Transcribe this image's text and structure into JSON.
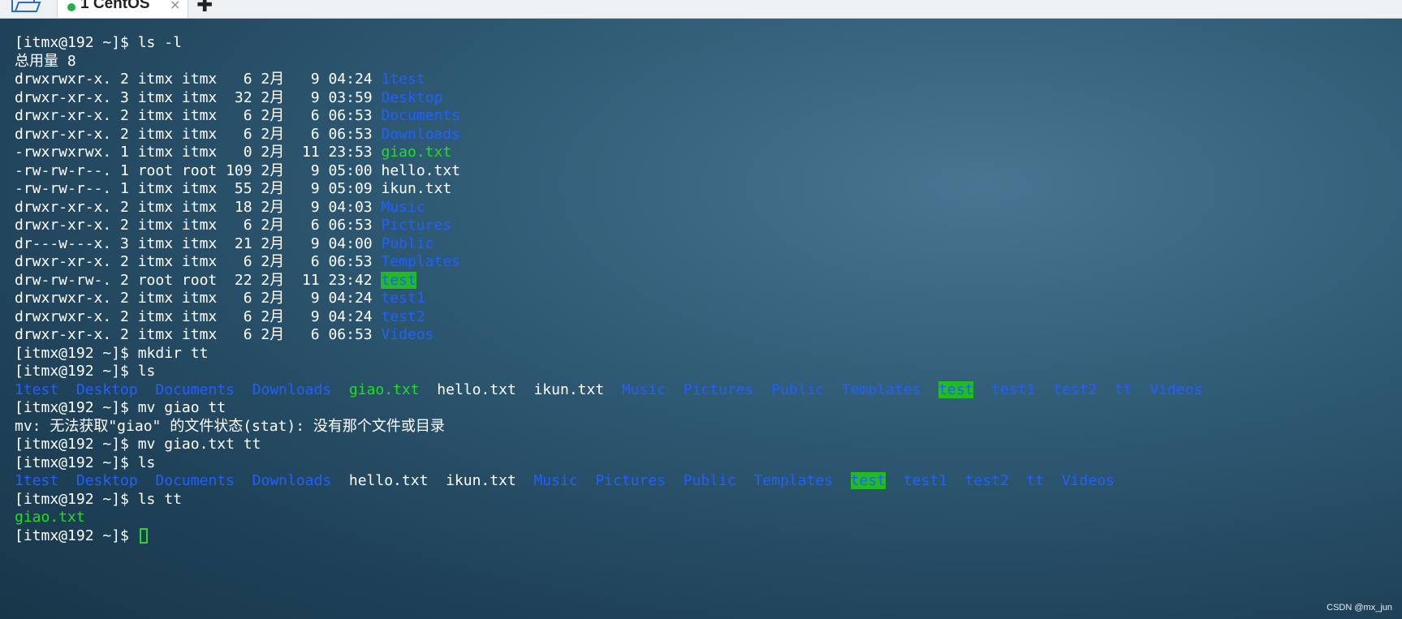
{
  "tabbar": {
    "tab_label": "1 CentOS",
    "tab_close": "×",
    "new_tab": "✚"
  },
  "terminal": {
    "lines": [
      [
        {
          "text": "[itmx@192 ~]$ ls -l",
          "style": "plain"
        }
      ],
      [
        {
          "text": "总用量 8",
          "style": "plain"
        }
      ],
      [
        {
          "text": "drwxrwxr-x. 2 itmx itmx   6 2月   9 04:24 ",
          "style": "plain"
        },
        {
          "text": "1test",
          "style": "dir"
        }
      ],
      [
        {
          "text": "drwxr-xr-x. 3 itmx itmx  32 2月   9 03:59 ",
          "style": "plain"
        },
        {
          "text": "Desktop",
          "style": "dir"
        }
      ],
      [
        {
          "text": "drwxr-xr-x. 2 itmx itmx   6 2月   6 06:53 ",
          "style": "plain"
        },
        {
          "text": "Documents",
          "style": "dir"
        }
      ],
      [
        {
          "text": "drwxr-xr-x. 2 itmx itmx   6 2月   6 06:53 ",
          "style": "plain"
        },
        {
          "text": "Downloads",
          "style": "dir"
        }
      ],
      [
        {
          "text": "-rwxrwxrwx. 1 itmx itmx   0 2月  11 23:53 ",
          "style": "plain"
        },
        {
          "text": "giao.txt",
          "style": "exe"
        }
      ],
      [
        {
          "text": "-rw-rw-r--. 1 root root 109 2月   9 05:00 hello.txt",
          "style": "plain"
        }
      ],
      [
        {
          "text": "-rw-rw-r--. 1 itmx itmx  55 2月   9 05:09 ikun.txt",
          "style": "plain"
        }
      ],
      [
        {
          "text": "drwxr-xr-x. 2 itmx itmx  18 2月   9 04:03 ",
          "style": "plain"
        },
        {
          "text": "Music",
          "style": "dir"
        }
      ],
      [
        {
          "text": "drwxr-xr-x. 2 itmx itmx   6 2月   6 06:53 ",
          "style": "plain"
        },
        {
          "text": "Pictures",
          "style": "dir"
        }
      ],
      [
        {
          "text": "dr---w---x. 3 itmx itmx  21 2月   9 04:00 ",
          "style": "plain"
        },
        {
          "text": "Public",
          "style": "dir"
        }
      ],
      [
        {
          "text": "drwxr-xr-x. 2 itmx itmx   6 2月   6 06:53 ",
          "style": "plain"
        },
        {
          "text": "Templates",
          "style": "dir"
        }
      ],
      [
        {
          "text": "drw-rw-rw-. 2 root root  22 2月  11 23:42 ",
          "style": "plain"
        },
        {
          "text": "test",
          "style": "hl"
        }
      ],
      [
        {
          "text": "drwxrwxr-x. 2 itmx itmx   6 2月   9 04:24 ",
          "style": "plain"
        },
        {
          "text": "test1",
          "style": "dir"
        }
      ],
      [
        {
          "text": "drwxrwxr-x. 2 itmx itmx   6 2月   9 04:24 ",
          "style": "plain"
        },
        {
          "text": "test2",
          "style": "dir"
        }
      ],
      [
        {
          "text": "drwxr-xr-x. 2 itmx itmx   6 2月   6 06:53 ",
          "style": "plain"
        },
        {
          "text": "Videos",
          "style": "dir"
        }
      ],
      [
        {
          "text": "[itmx@192 ~]$ mkdir tt",
          "style": "plain"
        }
      ],
      [
        {
          "text": "[itmx@192 ~]$ ls",
          "style": "plain"
        }
      ],
      [
        {
          "text": "1test",
          "style": "dir"
        },
        {
          "text": "  ",
          "style": "plain"
        },
        {
          "text": "Desktop",
          "style": "dir"
        },
        {
          "text": "  ",
          "style": "plain"
        },
        {
          "text": "Documents",
          "style": "dir"
        },
        {
          "text": "  ",
          "style": "plain"
        },
        {
          "text": "Downloads",
          "style": "dir"
        },
        {
          "text": "  ",
          "style": "plain"
        },
        {
          "text": "giao.txt",
          "style": "exe"
        },
        {
          "text": "  hello.txt  ikun.txt  ",
          "style": "plain"
        },
        {
          "text": "Music",
          "style": "dir"
        },
        {
          "text": "  ",
          "style": "plain"
        },
        {
          "text": "Pictures",
          "style": "dir"
        },
        {
          "text": "  ",
          "style": "plain"
        },
        {
          "text": "Public",
          "style": "dir"
        },
        {
          "text": "  ",
          "style": "plain"
        },
        {
          "text": "Templates",
          "style": "dir"
        },
        {
          "text": "  ",
          "style": "plain"
        },
        {
          "text": "test",
          "style": "hl"
        },
        {
          "text": "  ",
          "style": "plain"
        },
        {
          "text": "test1",
          "style": "dir"
        },
        {
          "text": "  ",
          "style": "plain"
        },
        {
          "text": "test2",
          "style": "dir"
        },
        {
          "text": "  ",
          "style": "plain"
        },
        {
          "text": "tt",
          "style": "dir"
        },
        {
          "text": "  ",
          "style": "plain"
        },
        {
          "text": "Videos",
          "style": "dir"
        }
      ],
      [
        {
          "text": "[itmx@192 ~]$ mv giao tt",
          "style": "plain"
        }
      ],
      [
        {
          "text": "mv: 无法获取\"giao\" 的文件状态(stat): 没有那个文件或目录",
          "style": "plain"
        }
      ],
      [
        {
          "text": "[itmx@192 ~]$ mv giao.txt tt",
          "style": "plain"
        }
      ],
      [
        {
          "text": "[itmx@192 ~]$ ls",
          "style": "plain"
        }
      ],
      [
        {
          "text": "1test",
          "style": "dir"
        },
        {
          "text": "  ",
          "style": "plain"
        },
        {
          "text": "Desktop",
          "style": "dir"
        },
        {
          "text": "  ",
          "style": "plain"
        },
        {
          "text": "Documents",
          "style": "dir"
        },
        {
          "text": "  ",
          "style": "plain"
        },
        {
          "text": "Downloads",
          "style": "dir"
        },
        {
          "text": "  hello.txt  ikun.txt  ",
          "style": "plain"
        },
        {
          "text": "Music",
          "style": "dir"
        },
        {
          "text": "  ",
          "style": "plain"
        },
        {
          "text": "Pictures",
          "style": "dir"
        },
        {
          "text": "  ",
          "style": "plain"
        },
        {
          "text": "Public",
          "style": "dir"
        },
        {
          "text": "  ",
          "style": "plain"
        },
        {
          "text": "Templates",
          "style": "dir"
        },
        {
          "text": "  ",
          "style": "plain"
        },
        {
          "text": "test",
          "style": "hl"
        },
        {
          "text": "  ",
          "style": "plain"
        },
        {
          "text": "test1",
          "style": "dir"
        },
        {
          "text": "  ",
          "style": "plain"
        },
        {
          "text": "test2",
          "style": "dir"
        },
        {
          "text": "  ",
          "style": "plain"
        },
        {
          "text": "tt",
          "style": "dir"
        },
        {
          "text": "  ",
          "style": "plain"
        },
        {
          "text": "Videos",
          "style": "dir"
        }
      ],
      [
        {
          "text": "[itmx@192 ~]$ ls tt",
          "style": "plain"
        }
      ],
      [
        {
          "text": "giao.txt",
          "style": "exe"
        }
      ],
      [
        {
          "text": "[itmx@192 ~]$ ",
          "style": "plain"
        }
      ]
    ]
  },
  "watermark": "CSDN @mx_jun"
}
